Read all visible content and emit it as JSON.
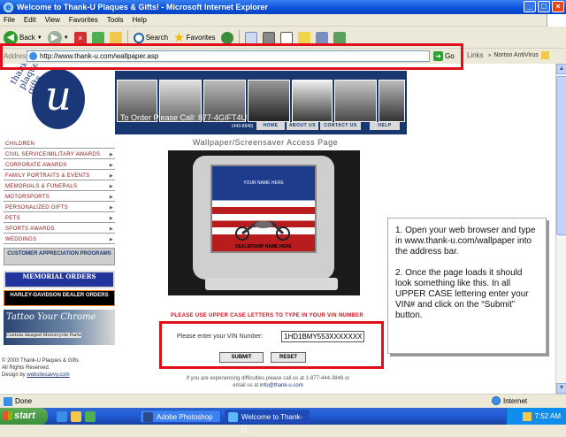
{
  "window": {
    "title": "Welcome to Thank-U Plaques & Gifts! - Microsoft Internet Explorer"
  },
  "menu": [
    "File",
    "Edit",
    "View",
    "Favorites",
    "Tools",
    "Help"
  ],
  "toolbar": {
    "back_label": "Back",
    "search_label": "Search",
    "favorites_label": "Favorites"
  },
  "address": {
    "label": "Address",
    "url": "http://www.thank-u.com/wallpaper.asp",
    "go_label": "Go",
    "links_label": "Links",
    "norton_label": "Norton AntiVirus"
  },
  "site": {
    "logo_text": "thank-u plaques gifts awards",
    "logo_letter": "u",
    "order_call": "To Order Please Call:  877-4GIFT4U",
    "phone_small": "(443-8848)",
    "nav": [
      "HOME",
      "ABOUT US",
      "CONTACT US",
      "HELP"
    ]
  },
  "sidebar": {
    "items": [
      "CHILDREN",
      "CIVIL SERVICE/MILITARY AWARDS",
      "CORPORATE AWARDS",
      "FAMILY PORTRAITS & EVENTS",
      "MEMORIALS & FUNERALS",
      "MOTORSPORTS",
      "PERSONALIZED GIFTS",
      "PETS",
      "SPORTS AWARDS",
      "WEDDINGS"
    ],
    "customer_appreciation": "CUSTOMER APPRECIATION PROGRAMS",
    "memorial": "MEMORIAL ORDERS",
    "harley": "HARLEY-DAVIDSON DEALER ORDERS",
    "tattoo_title": "Tattoo Your Chrome",
    "tattoo_sub": "Custom Imaged Motorcycle Parts",
    "copyright": "© 2003 Thank-U Plaques & Gifts",
    "rights": "All Rights Reserved.",
    "design_by": "Design by",
    "designer": "websitesavvy.com"
  },
  "main": {
    "page_title": "Wallpaper/Screensaver Access Page",
    "screen_text_top": "YOUR NAME HERE",
    "screen_text_bottom": "DEALERSHIP NAME HERE",
    "warning": "PLEASE USE UPPER CASE LETTERS TO TYPE IN YOUR VIN NUMBER",
    "vin_label": "Please enter your VIN Number:",
    "vin_value": "1HD1BMY553XXXXXXX",
    "submit_label": "SUBMIT",
    "reset_label": "RESET",
    "difficulties": "If you are experiencing difficulties please call us at 1-877-444-3848 or",
    "email_prefix": "email us at",
    "email": "info@thank-u.com"
  },
  "callout": {
    "step1": "1. Open your web browser and type in www.thank-u.com/wallpaper into the address bar.",
    "step2": "2. Once the page loads it should look something like this. In all UPPER CASE lettering enter your VIN# and click on the “Submit” button."
  },
  "status": {
    "text": "Done",
    "zone": "Internet"
  },
  "taskbar": {
    "start_label": "start",
    "tasks": [
      "Adobe Photoshop",
      "Welcome to Thank-U..."
    ],
    "clock": "7:52 AM"
  },
  "colors": {
    "highlight_red": "#e0101a",
    "brand_navy": "#17376e",
    "warning_red": "#d0101a"
  }
}
